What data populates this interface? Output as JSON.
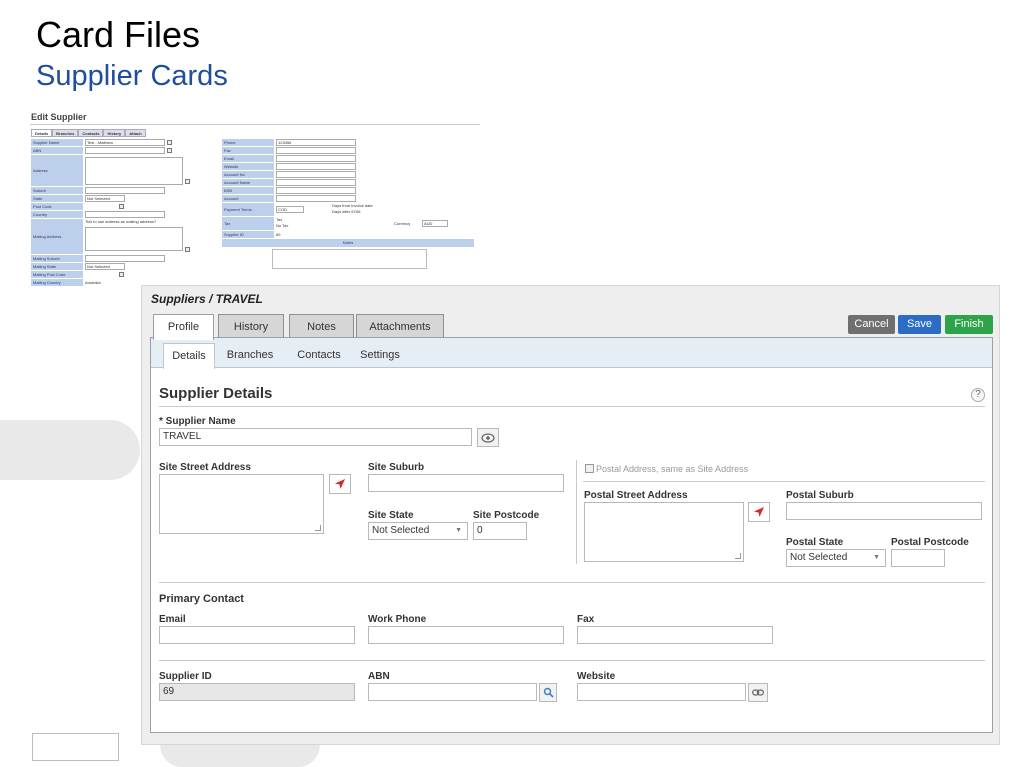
{
  "slide": {
    "title": "Card Files",
    "subtitle": "Supplier Cards"
  },
  "legacy": {
    "title": "Edit Supplier",
    "tabs": [
      "Details",
      "Branches",
      "Contacts",
      "History",
      "Attach"
    ],
    "left_rows": [
      {
        "label": "Supplier Name",
        "value": "Test - Matthew"
      },
      {
        "label": "ABN",
        "value": ""
      },
      {
        "label": "Address",
        "value": ""
      },
      {
        "label": "Suburb",
        "value": ""
      },
      {
        "label": "State",
        "value": "Not Selected"
      },
      {
        "label": "Post Code",
        "value": ""
      },
      {
        "label": "Country",
        "value": ""
      },
      {
        "label": "Mailing Address",
        "value": "Tick to use address as mailing address?"
      },
      {
        "label": "Mailing Suburb",
        "value": ""
      },
      {
        "label": "Mailing State",
        "value": "Not Selected"
      },
      {
        "label": "Mailing Post Code",
        "value": ""
      },
      {
        "label": "Mailing Country",
        "value": "Australia"
      }
    ],
    "right_rows": [
      {
        "label": "Phone",
        "value": "123456"
      },
      {
        "label": "Fax",
        "value": ""
      },
      {
        "label": "Email",
        "value": ""
      },
      {
        "label": "Website",
        "value": ""
      },
      {
        "label": "Account No",
        "value": ""
      },
      {
        "label": "Account Name",
        "value": ""
      },
      {
        "label": "BSB",
        "value": ""
      },
      {
        "label": "Account",
        "value": ""
      },
      {
        "label": "Payment Terms",
        "value": "COD"
      },
      {
        "label": "Tax",
        "value": "Tax"
      },
      {
        "label": "Supplier ID",
        "value": "69"
      }
    ],
    "payment_options": [
      "Days from invoice date",
      "Days after EOM"
    ],
    "tax_alt": "No Tax",
    "currency_label": "Currency",
    "currency_value": "AUD",
    "notes_label": "Notes"
  },
  "app": {
    "breadcrumb": "Suppliers / TRAVEL",
    "tabs": [
      "Profile",
      "History",
      "Notes",
      "Attachments"
    ],
    "buttons": {
      "cancel": "Cancel",
      "save": "Save",
      "finish": "Finish"
    },
    "subtabs": [
      "Details",
      "Branches",
      "Contacts",
      "Settings"
    ],
    "section_title": "Supplier Details",
    "help": "?",
    "supplier_name": {
      "label": "* Supplier Name",
      "value": "TRAVEL"
    },
    "site_street_address": {
      "label": "Site Street Address",
      "value": ""
    },
    "site_suburb": {
      "label": "Site Suburb",
      "value": ""
    },
    "site_state": {
      "label": "Site State",
      "value": "Not Selected"
    },
    "site_postcode": {
      "label": "Site Postcode",
      "value": "0"
    },
    "postal_same": {
      "label": "Postal Address, same as Site Address",
      "checked": false
    },
    "postal_street_address": {
      "label": "Postal Street Address",
      "value": ""
    },
    "postal_suburb": {
      "label": "Postal Suburb",
      "value": ""
    },
    "postal_state": {
      "label": "Postal State",
      "value": "Not Selected"
    },
    "postal_postcode": {
      "label": "Postal Postcode",
      "value": ""
    },
    "primary_contact": "Primary Contact",
    "email": {
      "label": "Email",
      "value": ""
    },
    "work_phone": {
      "label": "Work Phone",
      "value": ""
    },
    "fax": {
      "label": "Fax",
      "value": ""
    },
    "supplier_id": {
      "label": "Supplier ID",
      "value": "69"
    },
    "abn": {
      "label": "ABN",
      "value": ""
    },
    "website": {
      "label": "Website",
      "value": ""
    }
  },
  "colors": {
    "subtitle": "#1f4e9c",
    "save": "#2b6cc4",
    "finish": "#2ea44a",
    "cancel": "#6f6f6f",
    "location_icon": "#d42a2a"
  }
}
